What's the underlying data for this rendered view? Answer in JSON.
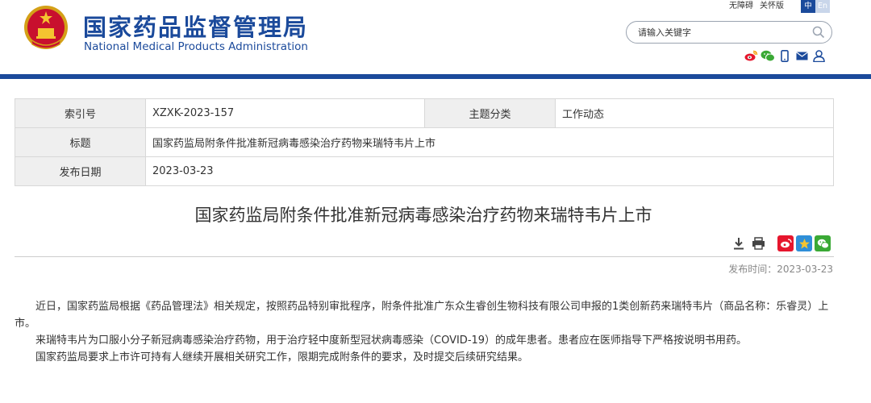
{
  "header": {
    "title_cn": "国家药品监督管理局",
    "title_en": "National Medical Products Administration",
    "top_links": [
      "无障碍",
      "关怀版"
    ],
    "lang": {
      "cn": "中",
      "en": "En"
    },
    "search_placeholder": "请输入关键字",
    "social_icons": [
      "weibo-icon",
      "wechat-icon",
      "mobile-icon",
      "mail-icon",
      "user-icon"
    ]
  },
  "meta": {
    "index_label": "索引号",
    "index_value": "XZXK-2023-157",
    "category_label": "主题分类",
    "category_value": "工作动态",
    "title_label": "标题",
    "title_value": "国家药监局附条件批准新冠病毒感染治疗药物来瑞特韦片上市",
    "date_label": "发布日期",
    "date_value": "2023-03-23"
  },
  "article": {
    "title": "国家药监局附条件批准新冠病毒感染治疗药物来瑞特韦片上市",
    "publish_time": "发布时间：2023-03-23",
    "paragraphs": [
      "近日，国家药监局根据《药品管理法》相关规定，按照药品特别审批程序，附条件批准广东众生睿创生物科技有限公司申报的1类创新药来瑞特韦片（商品名称：乐睿灵）上市。",
      "来瑞特韦片为口服小分子新冠病毒感染治疗药物，用于治疗轻中度新型冠状病毒感染（COVID-19）的成年患者。患者应在医师指导下严格按说明书用药。",
      "国家药监局要求上市许可持有人继续开展相关研究工作，限期完成附条件的要求，及时提交后续研究结果。"
    ]
  },
  "colors": {
    "brand_blue": "#1b4a9b",
    "weibo_red": "#e6162d",
    "qzone_blue": "#2f8fd8",
    "wechat_green": "#3aa935"
  }
}
